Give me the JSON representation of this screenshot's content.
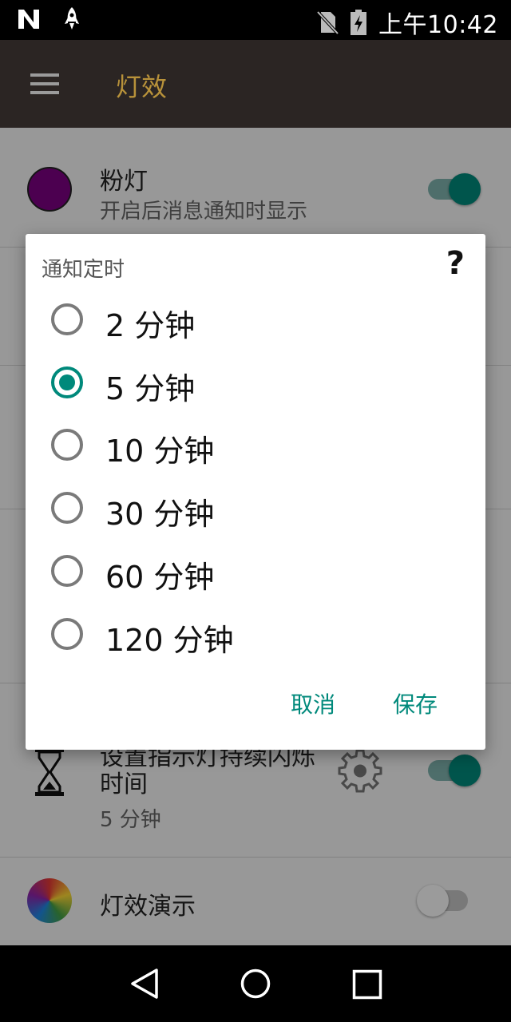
{
  "status_bar": {
    "time": "上午10:42",
    "icons": [
      "n-logo-icon",
      "rocket-icon",
      "no-sim-icon",
      "battery-charging-icon"
    ]
  },
  "app_bar": {
    "title": "灯效",
    "menu_icon": "hamburger-menu-icon"
  },
  "list": {
    "pink_light": {
      "title": "粉灯",
      "subtitle": "开启后消息通知时显示",
      "toggle": true,
      "color": "#7b0082"
    },
    "duration": {
      "title": "设置指示灯持续闪烁时间",
      "value": "5 分钟",
      "toggle": true
    },
    "demo": {
      "title": "灯效演示",
      "toggle": false
    }
  },
  "dialog": {
    "title": "通知定时",
    "help": "?",
    "options": [
      {
        "label": "2 分钟",
        "checked": false
      },
      {
        "label": "5 分钟",
        "checked": true
      },
      {
        "label": "10 分钟",
        "checked": false
      },
      {
        "label": "30 分钟",
        "checked": false
      },
      {
        "label": "60 分钟",
        "checked": false
      },
      {
        "label": "120 分钟",
        "checked": false
      }
    ],
    "cancel": "取消",
    "save": "保存"
  },
  "colors": {
    "accent": "#00897b",
    "appbar": "#2b2523",
    "title": "#b8923a"
  },
  "nav_bar": {
    "icons": [
      "back-icon",
      "home-icon",
      "recents-icon"
    ]
  }
}
